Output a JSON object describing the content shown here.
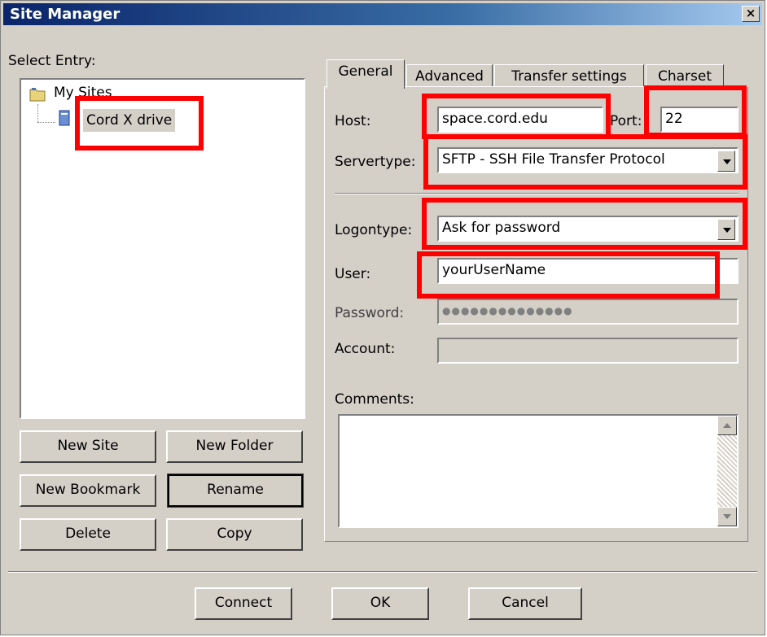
{
  "window": {
    "title": "Site Manager",
    "close_label": "×"
  },
  "select_entry": {
    "label": "Select Entry:"
  },
  "tree": {
    "root": "My Sites",
    "child": "Cord X drive"
  },
  "left_buttons": {
    "new_site": "New Site",
    "new_folder": "New Folder",
    "new_bookmark": "New Bookmark",
    "rename": "Rename",
    "delete": "Delete",
    "copy": "Copy"
  },
  "tabs": [
    "General",
    "Advanced",
    "Transfer settings",
    "Charset"
  ],
  "general": {
    "host_label": "Host:",
    "host_value": "space.cord.edu",
    "port_label": "Port:",
    "port_value": "22",
    "servertype_label": "Servertype:",
    "servertype_value": "SFTP - SSH File Transfer Protocol",
    "logontype_label": "Logontype:",
    "logontype_value": "Ask for password",
    "user_label": "User:",
    "user_value": "yourUserName",
    "password_label": "Password:",
    "password_value": "●●●●●●●●●●●●●●",
    "account_label": "Account:",
    "account_value": "",
    "comments_label": "Comments:",
    "comments_value": ""
  },
  "bottom_buttons": {
    "connect": "Connect",
    "ok": "OK",
    "cancel": "Cancel"
  },
  "colors": {
    "annotation": "#ff0000",
    "face": "#d4d0c8",
    "title_start": "#0a246a"
  }
}
